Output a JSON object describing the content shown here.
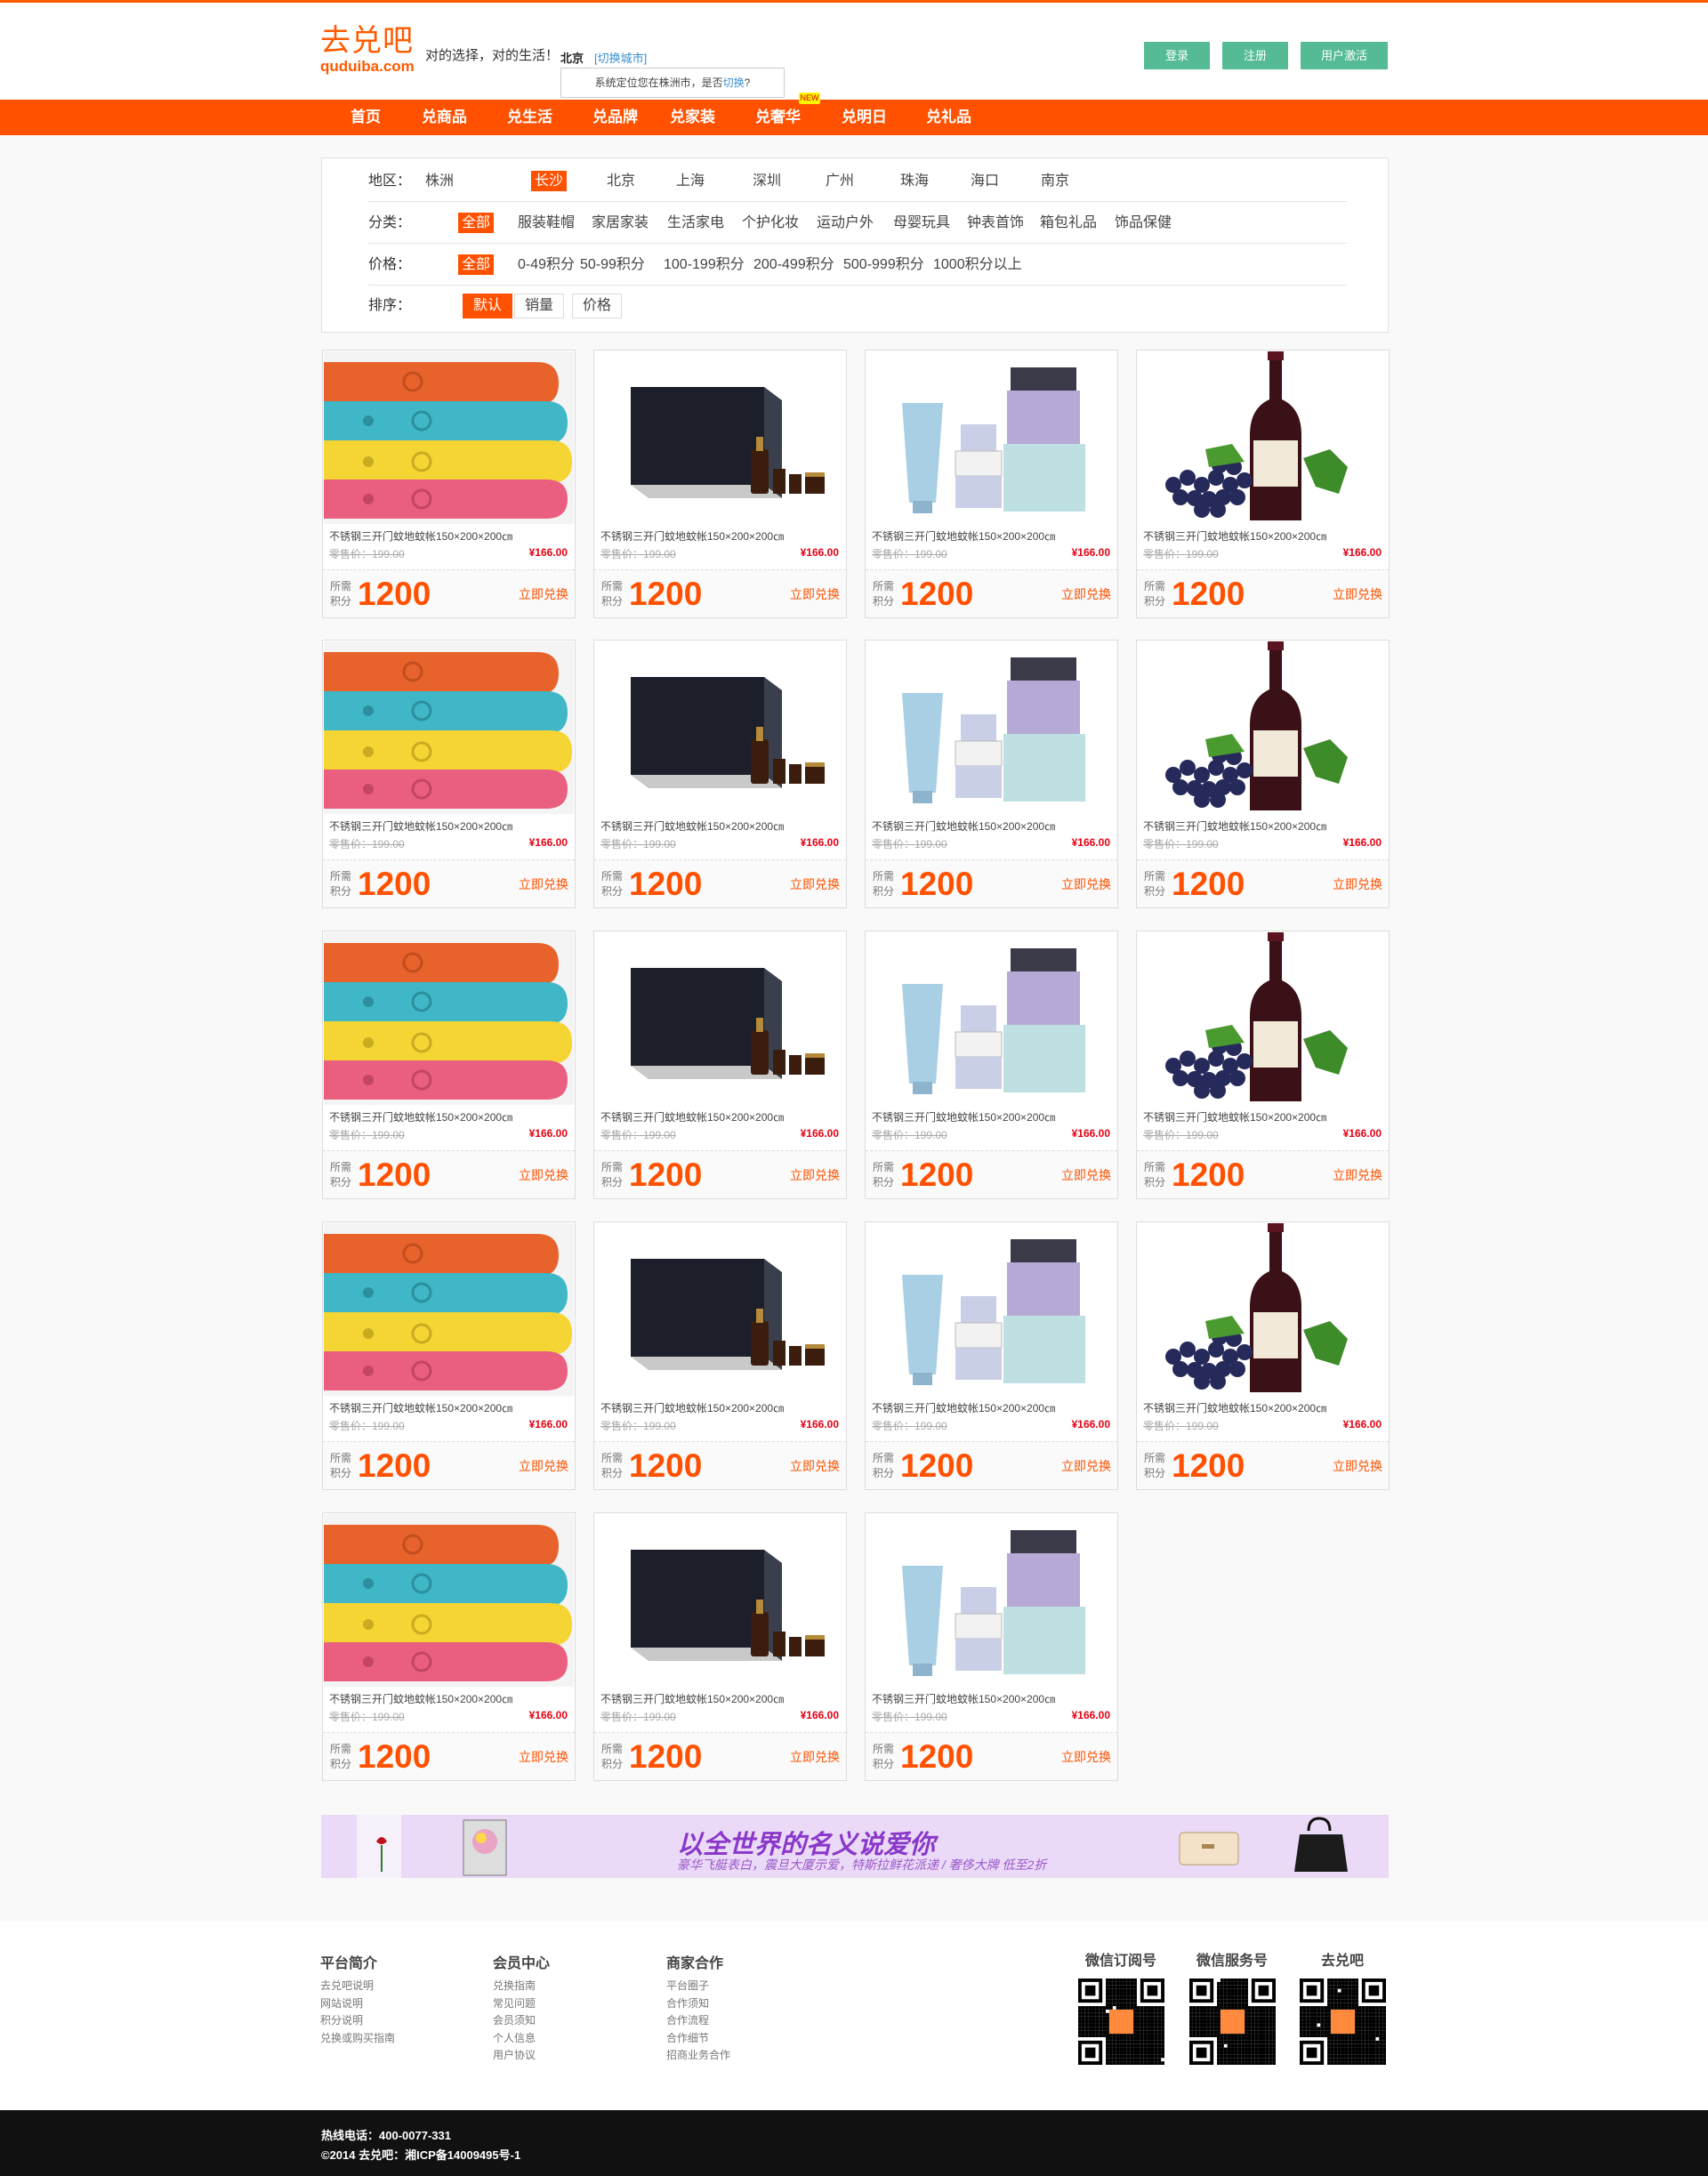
{
  "header": {
    "logo_cn": "去兑吧",
    "logo_en": "quduiba.com",
    "slogan": "对的选择，对的生活！",
    "city": "北京",
    "switch_city": "[切换城市]",
    "locate_prefix": "系统定位您在株洲市，是否",
    "locate_link": "切换",
    "locate_suffix": "?",
    "login": "登录",
    "register": "注册",
    "activate": "用户激活"
  },
  "nav": {
    "items": [
      "首页",
      "兑商品",
      "兑生活",
      "兑品牌",
      "兑家装",
      "兑奢华",
      "兑明日",
      "兑礼品"
    ],
    "badge": "NEW"
  },
  "filter": {
    "region": {
      "label": "地区：",
      "options": [
        "株洲",
        "长沙",
        "北京",
        "上海",
        "深圳",
        "广州",
        "珠海",
        "海口",
        "南京"
      ],
      "active": "长沙"
    },
    "category": {
      "label": "分类：",
      "options": [
        "全部",
        "服装鞋帽",
        "家居家装",
        "生活家电",
        "个护化妆",
        "运动户外",
        "母婴玩具",
        "钟表首饰",
        "箱包礼品",
        "饰品保健"
      ],
      "active": "全部"
    },
    "price": {
      "label": "价格：",
      "options": [
        "全部",
        "0-49积分",
        "50-99积分",
        "100-199积分",
        "200-499积分",
        "500-999积分",
        "1000积分以上"
      ],
      "active": "全部"
    },
    "sort": {
      "label": "排序：",
      "options": [
        "默认",
        "销量",
        "价格"
      ],
      "active": "默认"
    }
  },
  "product_common": {
    "title": "不锈钢三开门蚊地蚊帐150×200×200㎝",
    "orig": "零售价：199.00",
    "price": "¥166.00",
    "pts_label": "所需积分",
    "points": "1200",
    "redeem": "立即兑换"
  },
  "products": [
    {
      "image": "bracelets"
    },
    {
      "image": "giftbox"
    },
    {
      "image": "cosmetics"
    },
    {
      "image": "wine"
    },
    {
      "image": "bracelets"
    },
    {
      "image": "giftbox"
    },
    {
      "image": "cosmetics"
    },
    {
      "image": "wine"
    },
    {
      "image": "bracelets"
    },
    {
      "image": "giftbox"
    },
    {
      "image": "cosmetics"
    },
    {
      "image": "wine"
    },
    {
      "image": "bracelets"
    },
    {
      "image": "giftbox"
    },
    {
      "image": "cosmetics"
    },
    {
      "image": "wine"
    },
    {
      "image": "bracelets"
    },
    {
      "image": "giftbox"
    },
    {
      "image": "cosmetics"
    }
  ],
  "banner": {
    "title": "以全世界的名义说爱你",
    "subtitle": "豪华飞艇表白，震旦大厦示爱，特斯拉鲜花派递  /  奢侈大牌 低至2折"
  },
  "footer": {
    "cols": [
      {
        "title": "平台简介",
        "links": [
          "去兑吧说明",
          "网站说明",
          "积分说明",
          "兑换或购买指南"
        ]
      },
      {
        "title": "会员中心",
        "links": [
          "兑换指南",
          "常见问题",
          "会员须知",
          "个人信息",
          "用户协议"
        ]
      },
      {
        "title": "商家合作",
        "links": [
          "平台圈子",
          "合作须知",
          "合作流程",
          "合作细节",
          "招商业务合作"
        ]
      }
    ],
    "qr": [
      "微信订阅号",
      "微信服务号",
      "去兑吧"
    ]
  },
  "bottom": {
    "hotline": "热线电话：400-0077-331",
    "copyright": "©2014 去兑吧：湘ICP备14009495号-1"
  },
  "colors": {
    "accent": "#ff5100",
    "button": "#54bb95"
  }
}
